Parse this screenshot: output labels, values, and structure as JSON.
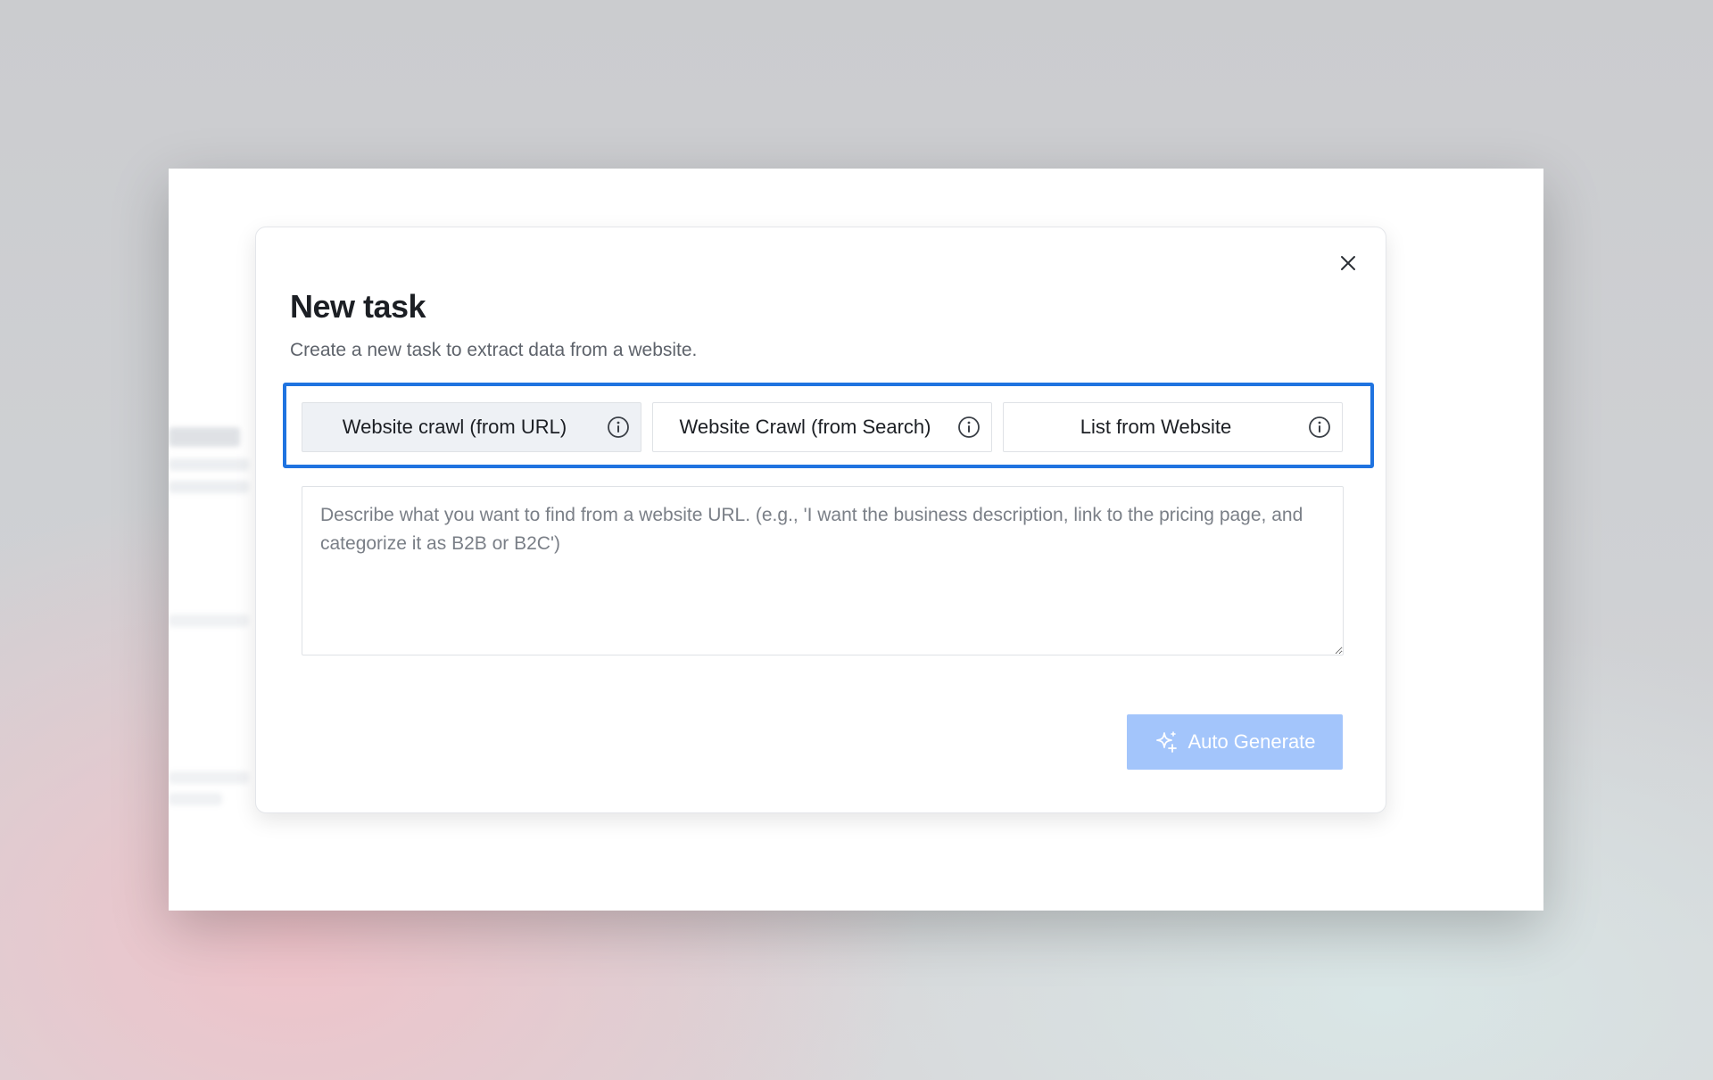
{
  "modal": {
    "title": "New task",
    "subtitle": "Create a new task to extract data from a website.",
    "close_icon": "close-icon"
  },
  "tabs": [
    {
      "label": "Website crawl (from URL)",
      "active": true,
      "icon": "info-icon"
    },
    {
      "label": "Website Crawl (from Search)",
      "active": false,
      "icon": "info-icon"
    },
    {
      "label": "List from Website",
      "active": false,
      "icon": "info-icon"
    }
  ],
  "description": {
    "value": "",
    "placeholder": "Describe what you want to find from a website URL. (e.g., 'I want the business description, link to the pricing page, and categorize it as B2B or B2C')"
  },
  "auto_generate": {
    "label": "Auto Generate",
    "icon": "sparkle-icon"
  },
  "colors": {
    "highlight_border": "#1f73e0",
    "button_bg": "#a3c5fb",
    "active_tab_bg": "#eef1f5"
  }
}
